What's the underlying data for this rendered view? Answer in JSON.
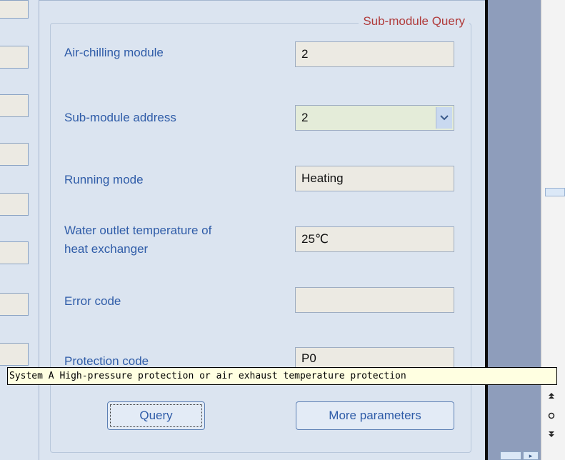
{
  "group": {
    "title": "Sub-module Query"
  },
  "fields": {
    "air_chilling_module": {
      "label": "Air-chilling module",
      "value": "2"
    },
    "sub_module_address": {
      "label": "Sub-module address",
      "value": "2"
    },
    "running_mode": {
      "label": "Running mode",
      "value": "Heating"
    },
    "water_outlet_temp": {
      "label_line1": "Water outlet temperature of",
      "label_line2": "heat exchanger",
      "value": "25℃"
    },
    "error_code": {
      "label": "Error code",
      "value": ""
    },
    "protection_code": {
      "label": "Protection code",
      "value": "P0"
    }
  },
  "tooltip": {
    "text": "System A High-pressure protection or air exhaust temperature protection"
  },
  "buttons": {
    "query": "Query",
    "more_parameters": "More parameters"
  },
  "icons": {
    "nav_up": "double-up-arrow",
    "nav_circle": "circle",
    "nav_down": "double-down-arrow",
    "select_arrow": "chevron-down"
  },
  "colors": {
    "label": "#2f5ca8",
    "group_title": "#b03a3a",
    "tooltip_bg": "#ffffe1",
    "background": "#dbe4f0"
  }
}
